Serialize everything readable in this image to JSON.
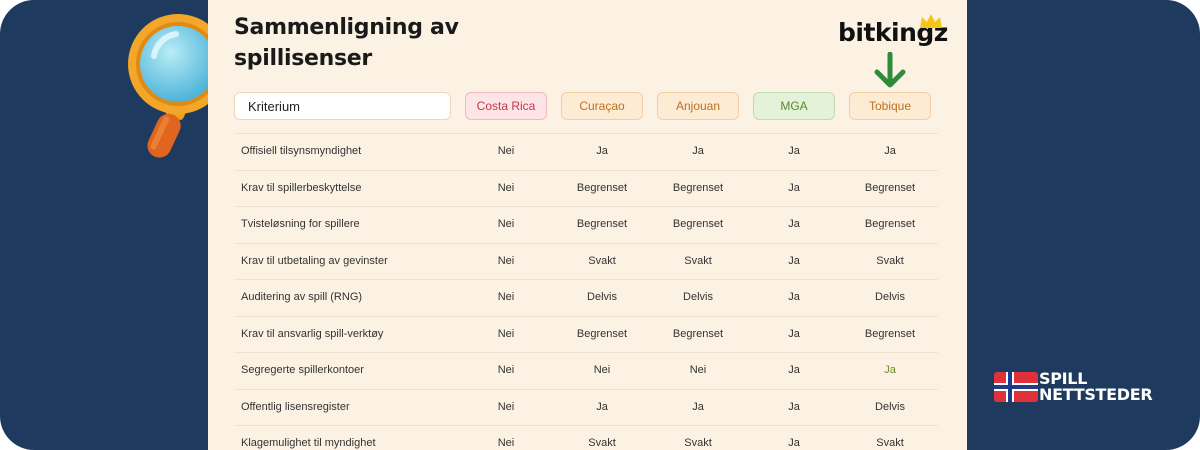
{
  "title": "Sammenligning av spillisenser",
  "brand": {
    "name": "bitkingz",
    "accent": "#f5c518"
  },
  "header": {
    "kriterium": "Kriterium",
    "columns": [
      {
        "label": "Costa Rica",
        "bg": "#fde4e6",
        "border": "#f1b8bf",
        "color": "#c0394b"
      },
      {
        "label": "Curaçao",
        "bg": "#fdebd4",
        "border": "#f0cfa3",
        "color": "#b8731f"
      },
      {
        "label": "Anjouan",
        "bg": "#fdebd4",
        "border": "#f0cfa3",
        "color": "#b8731f"
      },
      {
        "label": "MGA",
        "bg": "#e3f2d8",
        "border": "#bfddaa",
        "color": "#5c8a2e"
      },
      {
        "label": "Tobique",
        "bg": "#fdebd4",
        "border": "#f0cfa3",
        "color": "#b8731f"
      }
    ]
  },
  "rows": [
    {
      "criterion": "Offisiell tilsynsmyndighet",
      "values": [
        "Nei",
        "Ja",
        "Ja",
        "Ja",
        "Ja"
      ]
    },
    {
      "criterion": "Krav til spillerbeskyttelse",
      "values": [
        "Nei",
        "Begrenset",
        "Begrenset",
        "Ja",
        "Begrenset"
      ]
    },
    {
      "criterion": "Tvisteløsning for spillere",
      "values": [
        "Nei",
        "Begrenset",
        "Begrenset",
        "Ja",
        "Begrenset"
      ]
    },
    {
      "criterion": "Krav til utbetaling av gevinster",
      "values": [
        "Nei",
        "Svakt",
        "Svakt",
        "Ja",
        "Svakt"
      ]
    },
    {
      "criterion": "Auditering av spill (RNG)",
      "values": [
        "Nei",
        "Delvis",
        "Delvis",
        "Ja",
        "Delvis"
      ]
    },
    {
      "criterion": "Krav til ansvarlig spill-verktøy",
      "values": [
        "Nei",
        "Begrenset",
        "Begrenset",
        "Ja",
        "Begrenset"
      ]
    },
    {
      "criterion": "Segregerte spillerkontoer",
      "values": [
        "Nei",
        "Nei",
        "Nei",
        "Ja",
        "Ja"
      ]
    },
    {
      "criterion": "Offentlig lisensregister",
      "values": [
        "Nei",
        "Ja",
        "Ja",
        "Ja",
        "Delvis"
      ]
    },
    {
      "criterion": "Klagemulighet til myndighet",
      "values": [
        "Nei",
        "Svakt",
        "Svakt",
        "Ja",
        "Svakt"
      ]
    }
  ],
  "highlight": {
    "row": 6,
    "col": 4,
    "color": "#6b8e23"
  },
  "logo": {
    "line1": "SPILL",
    "line2": "NETTSTEDER",
    "icon": "norway-flag-icon"
  },
  "decor": {
    "magnifier": "magnifying-glass-icon",
    "arrow": "arrow-down-icon",
    "arrow_color": "#2e8b3a"
  }
}
